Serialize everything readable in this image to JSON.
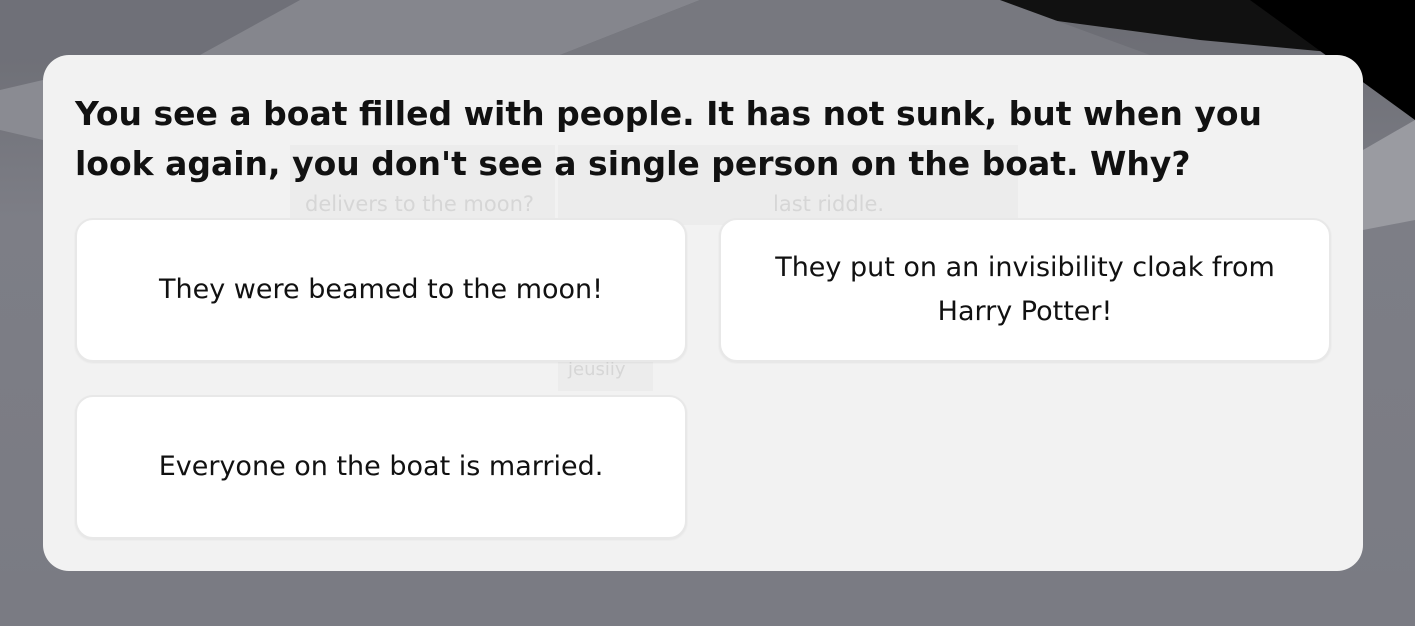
{
  "question": "You see a boat filled with people. It has not sunk, but when you look again, you don't see a single person on the boat. Why?",
  "answers": [
    "They were beamed to the moon!",
    "They put on an invisibility cloak from Harry Potter!",
    "Everyone on the boat is married."
  ],
  "background_ghost_text": [
    "delivers to the moon?",
    "last riddle.",
    "jeusiiy"
  ],
  "colors": {
    "background": "#7b7c84",
    "card": "#f2f2f2",
    "answer_bg": "#ffffff",
    "text": "#111111"
  }
}
